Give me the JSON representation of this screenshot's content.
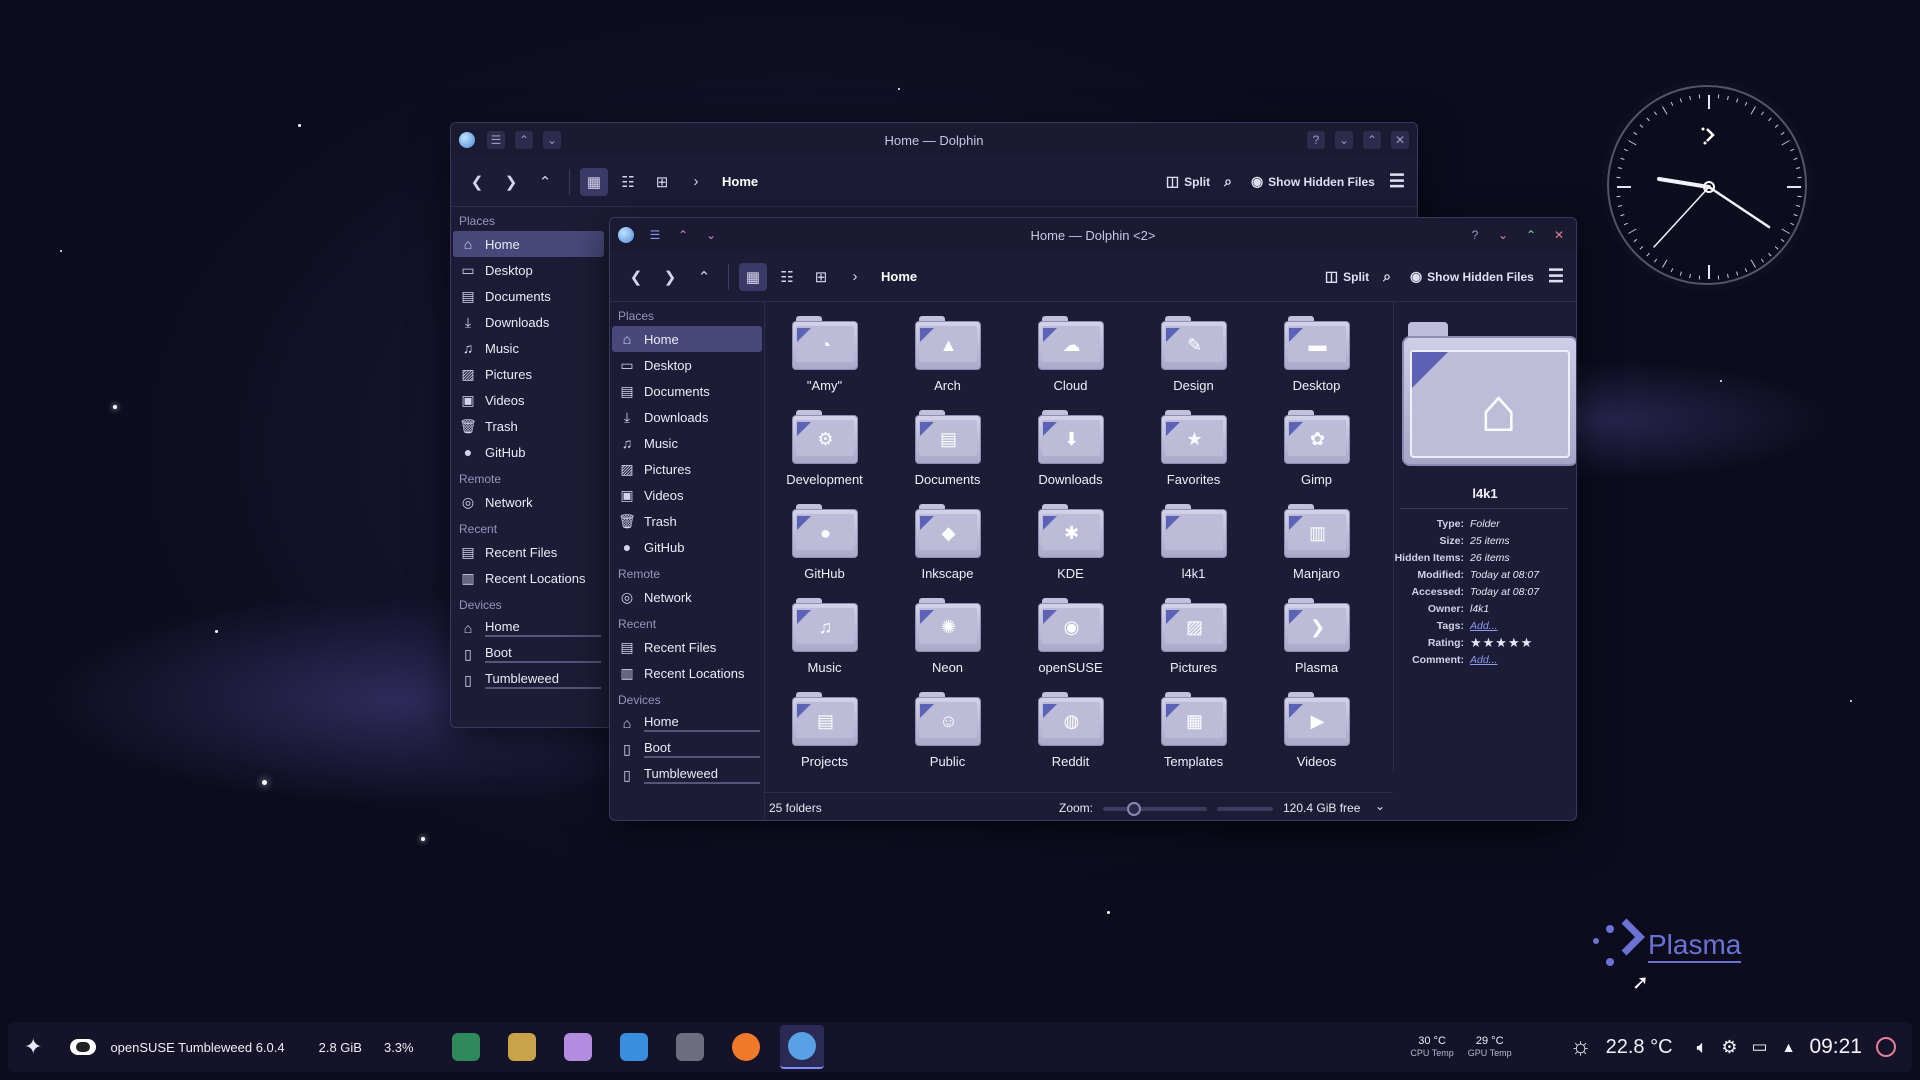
{
  "window_back": {
    "title": "Home — Dolphin",
    "crumb": "Home",
    "split_label": "Split",
    "hidden_label": "Show Hidden Files",
    "places_label": "Places",
    "places": [
      "Home",
      "Desktop",
      "Documents",
      "Downloads",
      "Music",
      "Pictures",
      "Videos",
      "Trash",
      "GitHub"
    ],
    "remote_label": "Remote",
    "remote": [
      "Network"
    ],
    "recent_label": "Recent",
    "recent": [
      "Recent Files",
      "Recent Locations"
    ],
    "devices_label": "Devices",
    "devices": [
      "Home",
      "Boot",
      "Tumbleweed"
    ]
  },
  "window_front": {
    "title": "Home — Dolphin <2>",
    "crumb": "Home",
    "split_label": "Split",
    "hidden_label": "Show Hidden Files",
    "places_label": "Places",
    "places": [
      "Home",
      "Desktop",
      "Documents",
      "Downloads",
      "Music",
      "Pictures",
      "Videos",
      "Trash",
      "GitHub"
    ],
    "remote_label": "Remote",
    "remote": [
      "Network"
    ],
    "recent_label": "Recent",
    "recent": [
      "Recent Files",
      "Recent Locations"
    ],
    "devices_label": "Devices",
    "devices": [
      "Home",
      "Boot",
      "Tumbleweed"
    ],
    "folders": [
      "\"Amy\"",
      "Arch",
      "Cloud",
      "Design",
      "Desktop",
      "Development",
      "Documents",
      "Downloads",
      "Favorites",
      "Gimp",
      "GitHub",
      "Inkscape",
      "KDE",
      "l4k1",
      "Manjaro",
      "Music",
      "Neon",
      "openSUSE",
      "Pictures",
      "Plasma",
      "Projects",
      "Public",
      "Reddit",
      "Templates",
      "Videos"
    ],
    "info": {
      "name": "l4k1",
      "rows": [
        {
          "k": "Type:",
          "v": "Folder"
        },
        {
          "k": "Size:",
          "v": "25 items"
        },
        {
          "k": "Hidden Items:",
          "v": "26 items"
        },
        {
          "k": "Modified:",
          "v": "Today at 08:07"
        },
        {
          "k": "Accessed:",
          "v": "Today at 08:07"
        },
        {
          "k": "Owner:",
          "v": "l4k1"
        },
        {
          "k": "Tags:",
          "v": "Add..."
        },
        {
          "k": "Rating:",
          "v": "★★★★★"
        },
        {
          "k": "Comment:",
          "v": "Add..."
        }
      ]
    },
    "status": {
      "count": "25 folders",
      "zoom_label": "Zoom:",
      "free": "120.4 GiB free",
      "zoom_level": 0.3
    }
  },
  "panel": {
    "os_label": "openSUSE Tumbleweed 6.0.4",
    "mem": "2.8 GiB",
    "cpu": "3.3%",
    "cpu_temp": "30 °C",
    "cpu_temp_label": "CPU Temp",
    "gpu_temp": "29 °C",
    "gpu_temp_label": "GPU Temp",
    "weather": "22.8 °C",
    "time": "09:21",
    "task_icons": [
      "image-viewer-icon",
      "terminal-icon",
      "game-icon",
      "store-icon",
      "settings-icon",
      "firefox-icon",
      "dolphin-icon"
    ]
  },
  "desktop": {
    "plasma_label": "Plasma"
  },
  "colors": {
    "accent": "#5c63b7",
    "selection": "#49487a",
    "link": "#8e9af0"
  }
}
